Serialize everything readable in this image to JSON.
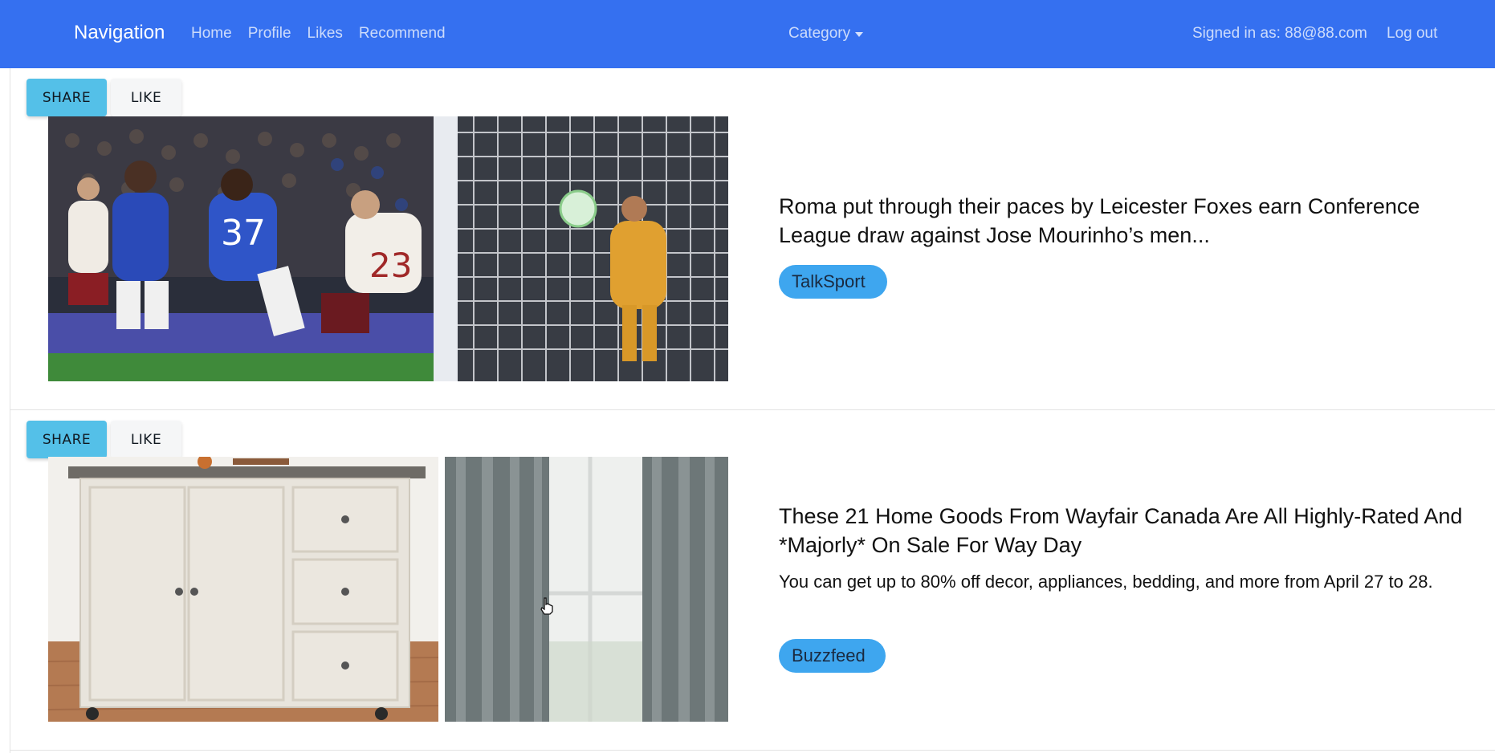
{
  "navbar": {
    "brand": "Navigation",
    "links": [
      "Home",
      "Profile",
      "Likes",
      "Recommend"
    ],
    "category": "Category",
    "signed_in": "Signed in as: 88@88.com",
    "logout": "Log out",
    "color": "#3570f0"
  },
  "articles": [
    {
      "share": "SHARE",
      "like": "LIKE",
      "title": "Roma put through their paces by Leicester Foxes earn Conference League draw against Jose Mourinho’s men...",
      "source": "TalkSport"
    },
    {
      "share": "SHARE",
      "like": "LIKE",
      "title": "These 21 Home Goods From Wayfair Canada Are All Highly-Rated And *Majorly* On Sale For Way Day",
      "description": "You can get up to 80% off decor, appliances, bedding, and more from April 27 to 28.",
      "source": "Buzzfeed"
    }
  ],
  "colors": {
    "share_button": "#54c0e8",
    "like_button": "#f5f6f7",
    "source_pill": "#3ea6ef"
  }
}
